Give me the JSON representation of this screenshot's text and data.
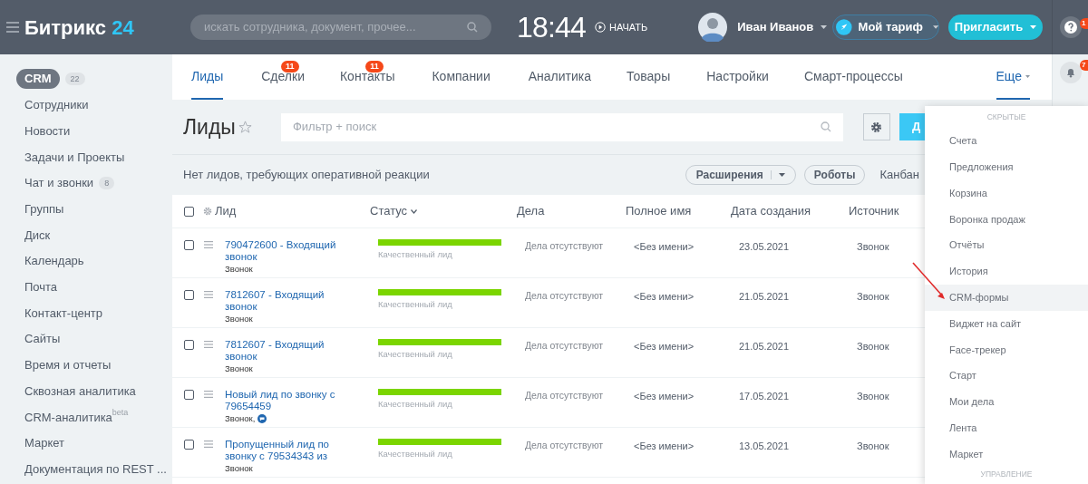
{
  "header": {
    "logo_main": "Битрикс",
    "logo_num": "24",
    "search": {
      "placeholder": "искать сотрудника, документ, прочее..."
    },
    "time": "18:44",
    "start": "НАЧАТЬ",
    "user": "Иван Иванов",
    "tariff": "Мой тариф",
    "invite": "Пригласить"
  },
  "right_strip": {
    "help_badge": "1",
    "bell_badge": "7"
  },
  "sidebar": {
    "items": [
      {
        "label": "CRM",
        "selected": true,
        "count": "22"
      },
      {
        "label": "Сотрудники",
        "selected": false
      },
      {
        "label": "Новости",
        "selected": false
      },
      {
        "label": "Задачи и Проекты",
        "selected": false
      },
      {
        "label": "Чат и звонки",
        "selected": false,
        "count": "8"
      },
      {
        "label": "Группы",
        "selected": false
      },
      {
        "label": "Диск",
        "selected": false
      },
      {
        "label": "Календарь",
        "selected": false
      },
      {
        "label": "Почта",
        "selected": false
      },
      {
        "label": "Контакт-центр",
        "selected": false
      },
      {
        "label": "Сайты",
        "selected": false
      },
      {
        "label": "Время и отчеты",
        "selected": false
      },
      {
        "label": "Сквозная аналитика",
        "selected": false
      },
      {
        "label": "CRM-аналитика",
        "selected": false,
        "sup": "beta"
      },
      {
        "label": "Маркет",
        "selected": false
      },
      {
        "label": "Документация по REST ...",
        "selected": false
      }
    ]
  },
  "tabs": [
    {
      "label": "Лиды",
      "selected": true
    },
    {
      "label": "Сделки",
      "selected": false,
      "badge": "11"
    },
    {
      "label": "Контакты",
      "selected": false,
      "badge": "11"
    },
    {
      "label": "Компании",
      "selected": false
    },
    {
      "label": "Аналитика",
      "selected": false
    },
    {
      "label": "Товары",
      "selected": false
    },
    {
      "label": "Настройки",
      "selected": false
    },
    {
      "label": "Смарт-процессы",
      "selected": false
    },
    {
      "label": "Еще",
      "selected": true,
      "kind": "more"
    }
  ],
  "page": {
    "title": "Лиды",
    "filter": {
      "placeholder": "Фильтр + поиск"
    },
    "add_button": "Д",
    "notice": "Нет лидов, требующих оперативной реакции",
    "extensions": "Расширения",
    "robots": "Роботы",
    "kanban": "Канбан"
  },
  "table": {
    "select_all_checked": false,
    "columns": [
      "Лид",
      "Статус",
      "Дела",
      "Полное имя",
      "Дата создания",
      "Источник"
    ],
    "rows": [
      {
        "checked": false,
        "lead": "790472600 - Входящий звонок",
        "sub": "Звонок",
        "status": "Качественный лид",
        "level": 1,
        "deals": "Дела отсутствуют",
        "name": "<Без имени>",
        "date": "23.05.2021",
        "source": "Звонок"
      },
      {
        "checked": false,
        "lead": "7812607 - Входящий звонок",
        "sub": "Звонок",
        "status": "Качественный лид",
        "level": 1,
        "deals": "Дела отсутствуют",
        "name": "<Без имени>",
        "date": "21.05.2021",
        "source": "Звонок"
      },
      {
        "checked": false,
        "lead": "7812607 - Входящий звонок",
        "sub": "Звонок",
        "status": "Качественный лид",
        "level": 1,
        "deals": "Дела отсутствуют",
        "name": "<Без имени>",
        "date": "21.05.2021",
        "source": "Звонок"
      },
      {
        "checked": false,
        "lead": "Новый лид по звонку с 79654459",
        "sub": "Звонок,",
        "sub_icon": true,
        "status": "Качественный лид",
        "level": 1,
        "deals": "Дела отсутствуют",
        "name": "<Без имени>",
        "date": "17.05.2021",
        "source": "Звонок"
      },
      {
        "checked": false,
        "lead": "Пропущенный лид по звонку с 79534343 из",
        "sub": "Звонок",
        "status": "Качественный лид",
        "level": 1,
        "deals": "Дела отсутствуют",
        "name": "<Без имени>",
        "date": "13.05.2021",
        "source": "Звонок"
      }
    ]
  },
  "menu": {
    "section_top": "СКРЫТЫЕ",
    "items": [
      {
        "label": "Счета",
        "selected": false
      },
      {
        "label": "Предложения",
        "selected": false
      },
      {
        "label": "Корзина",
        "selected": false
      },
      {
        "label": "Воронка продаж",
        "selected": false
      },
      {
        "label": "Отчёты",
        "selected": false
      },
      {
        "label": "История",
        "selected": false
      },
      {
        "label": "CRM-формы",
        "selected": true
      },
      {
        "label": "Виджет на сайт",
        "selected": false
      },
      {
        "label": "Face-трекер",
        "selected": false
      },
      {
        "label": "Старт",
        "selected": false
      },
      {
        "label": "Мои дела",
        "selected": false
      },
      {
        "label": "Лента",
        "selected": false
      },
      {
        "label": "Маркет",
        "selected": false
      }
    ],
    "section_bottom": "УПРАВЛЕНИЕ"
  }
}
